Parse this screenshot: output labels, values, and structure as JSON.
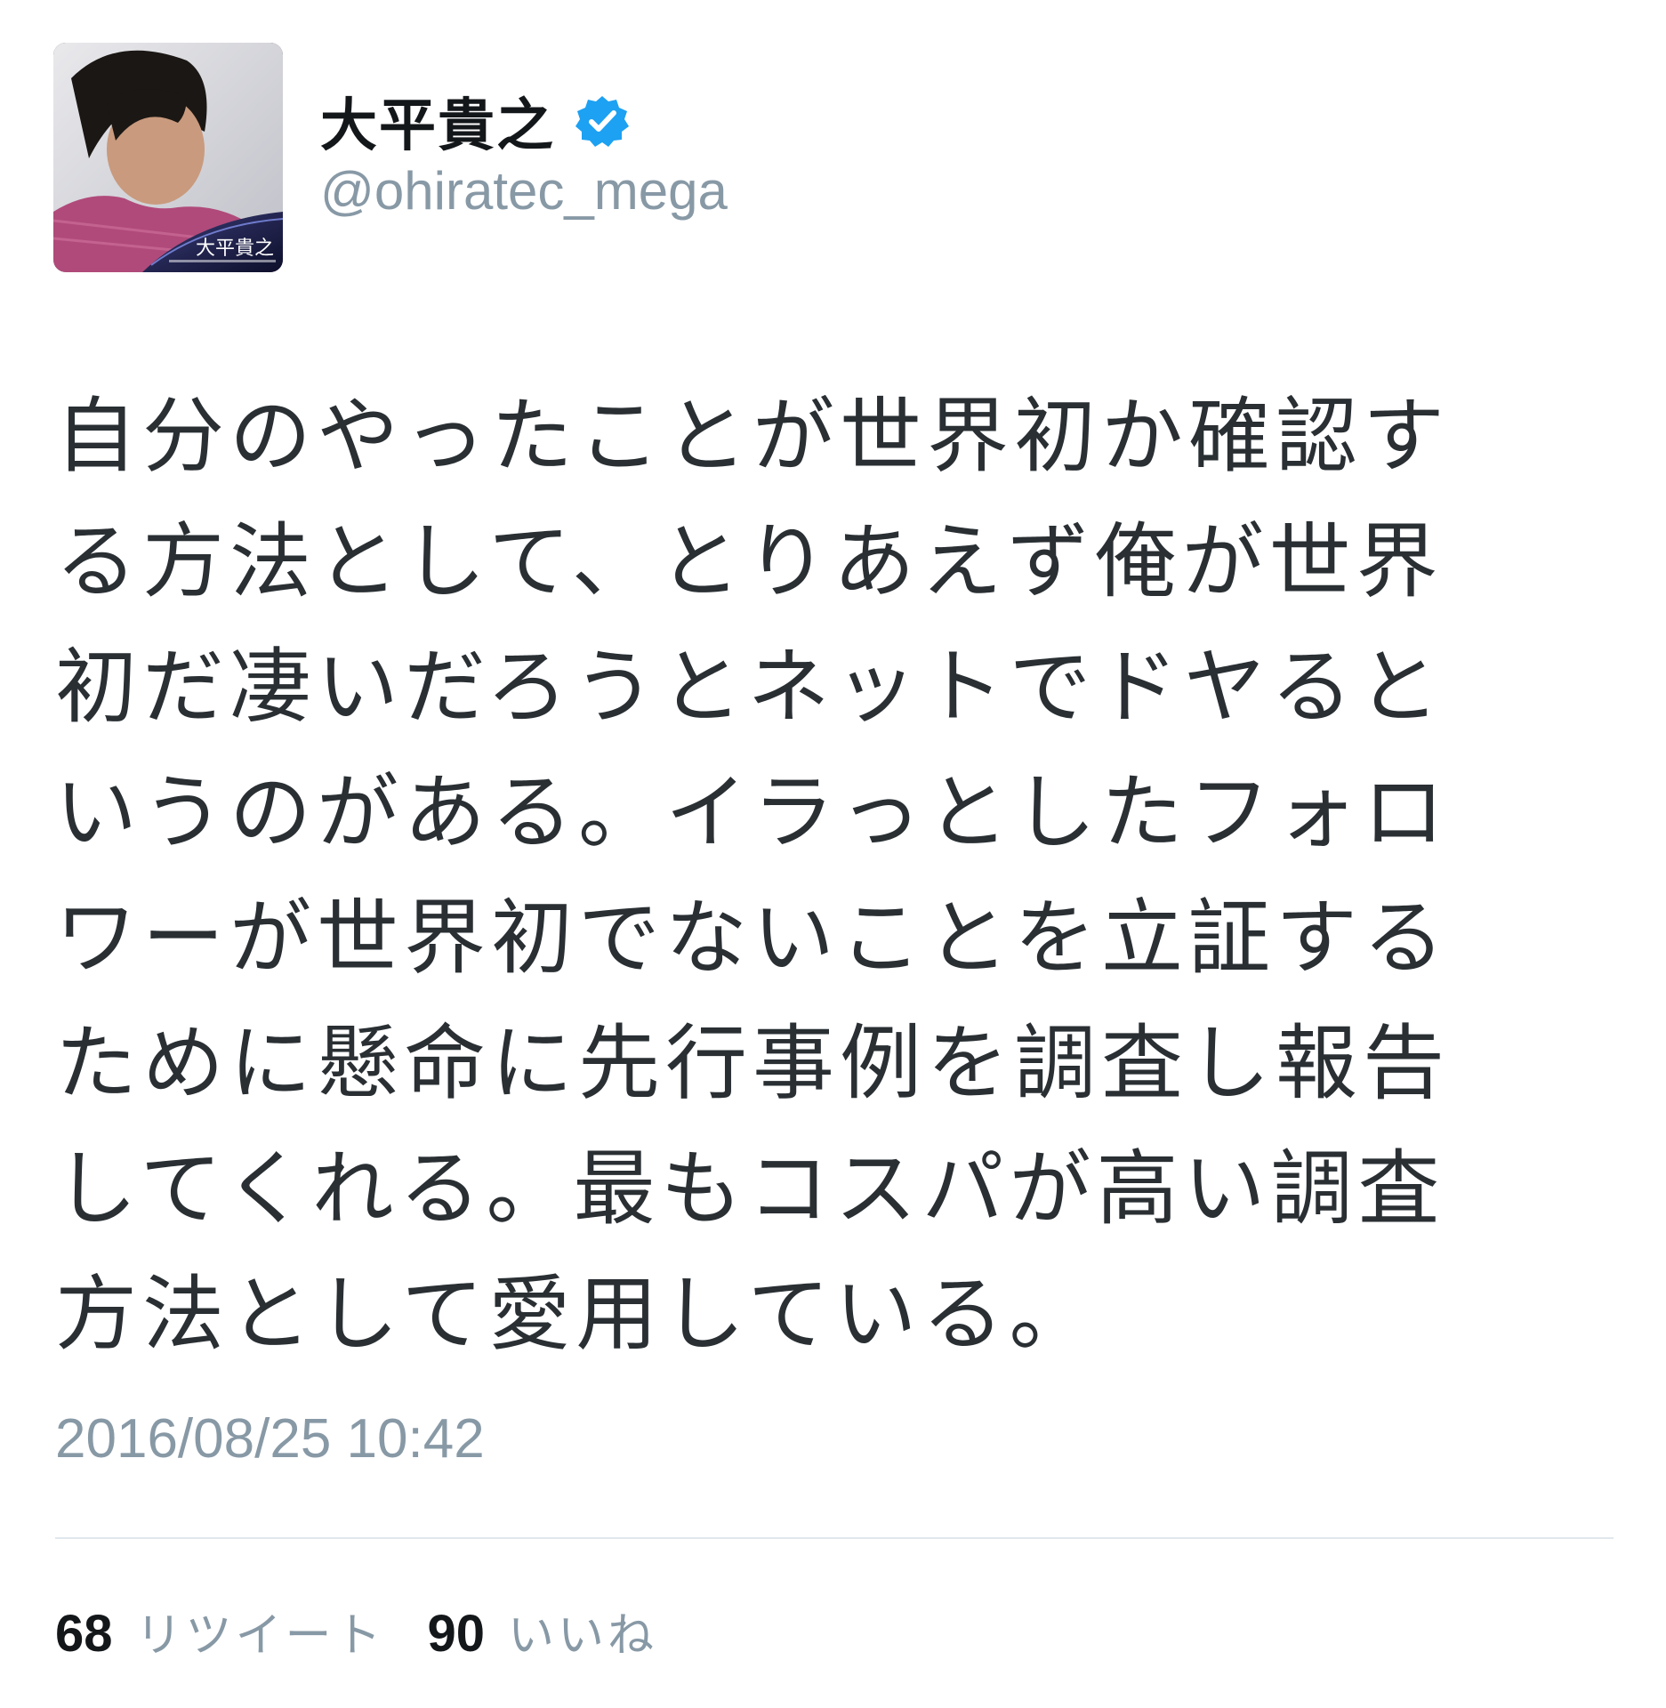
{
  "author": {
    "display_name": "大平貴之",
    "handle": "@ohiratec_mega",
    "verified": true,
    "avatar_caption": "大平貴之"
  },
  "tweet": {
    "text_lines": [
      "自分のやったことが世界初か確認す",
      "る方法として、とりあえず俺が世界",
      "初だ凄いだろうとネットでドヤると",
      "いうのがある。イラっとしたフォロ",
      "ワーが世界初でないことを立証する",
      "ために懸命に先行事例を調査し報告",
      "してくれる。最もコスパが高い調査",
      "方法として愛用している。"
    ],
    "timestamp": "2016/08/25 10:42"
  },
  "stats": {
    "retweets_count": "68",
    "retweets_label": "リツイート",
    "likes_count": "90",
    "likes_label": "いいね"
  },
  "colors": {
    "text": "#292f33",
    "muted": "#8899a6",
    "verified_badge": "#1da1f2",
    "divider": "#e1e8ed"
  }
}
